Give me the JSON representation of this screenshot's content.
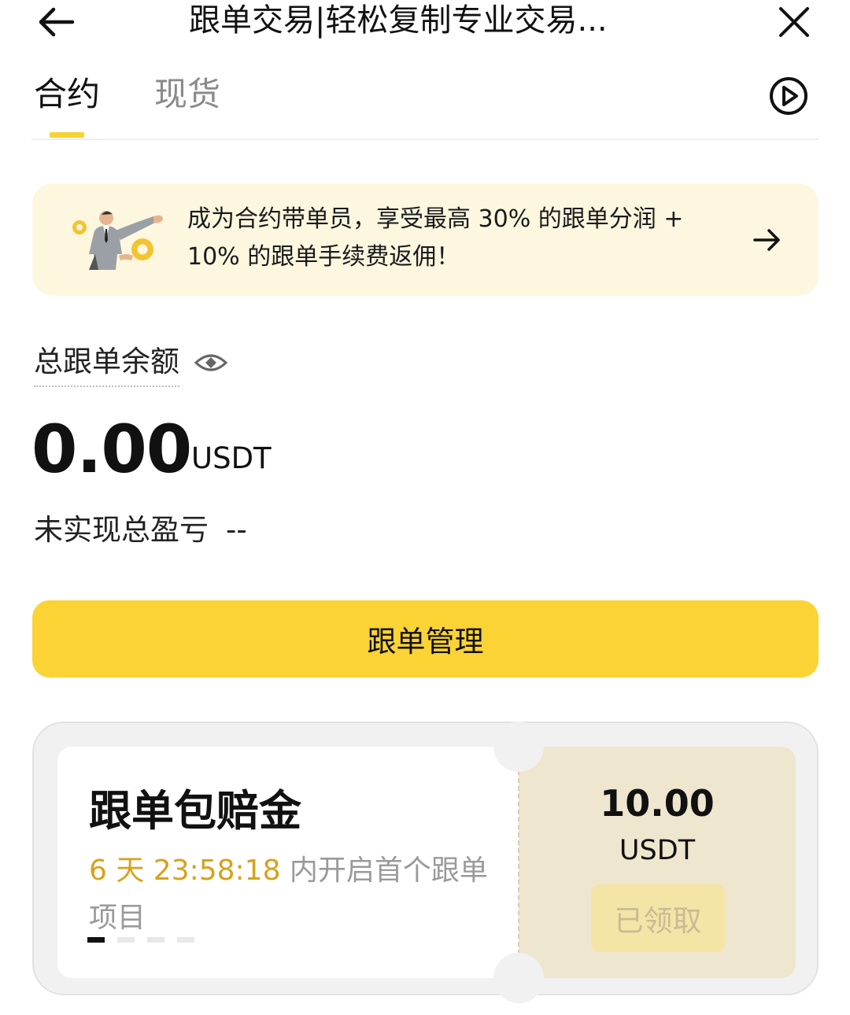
{
  "header": {
    "title": "跟单交易|轻松复制专业交易...",
    "back_icon": "arrow-left-icon",
    "close_icon": "close-icon"
  },
  "tabs": {
    "items": [
      {
        "label": "合约",
        "active": true
      },
      {
        "label": "现货",
        "active": false
      }
    ],
    "play_icon": "play-circle-icon",
    "accent_color": "#F7D233"
  },
  "promo": {
    "text": "成为合约带单员，享受最高 30% 的跟单分润 + 10% 的跟单手续费返佣！",
    "arrow_icon": "arrow-right-icon",
    "background": "#FDF7E0"
  },
  "balance": {
    "label": "总跟单余额",
    "eye_icon": "eye-icon",
    "value": "0.00",
    "unit": "USDT",
    "pnl_label": "未实现总盈亏",
    "pnl_value": "--"
  },
  "manage_button": {
    "label": "跟单管理",
    "color": "#FBD335"
  },
  "coupon": {
    "title": "跟单包赔金",
    "countdown": "6 天 23:58:18",
    "desc_rest": " 内开启首个跟单项目",
    "amount": "10.00",
    "unit": "USDT",
    "button_label": "已领取",
    "countdown_color": "#D6A21A",
    "carousel_count": 4,
    "carousel_active_index": 0
  }
}
